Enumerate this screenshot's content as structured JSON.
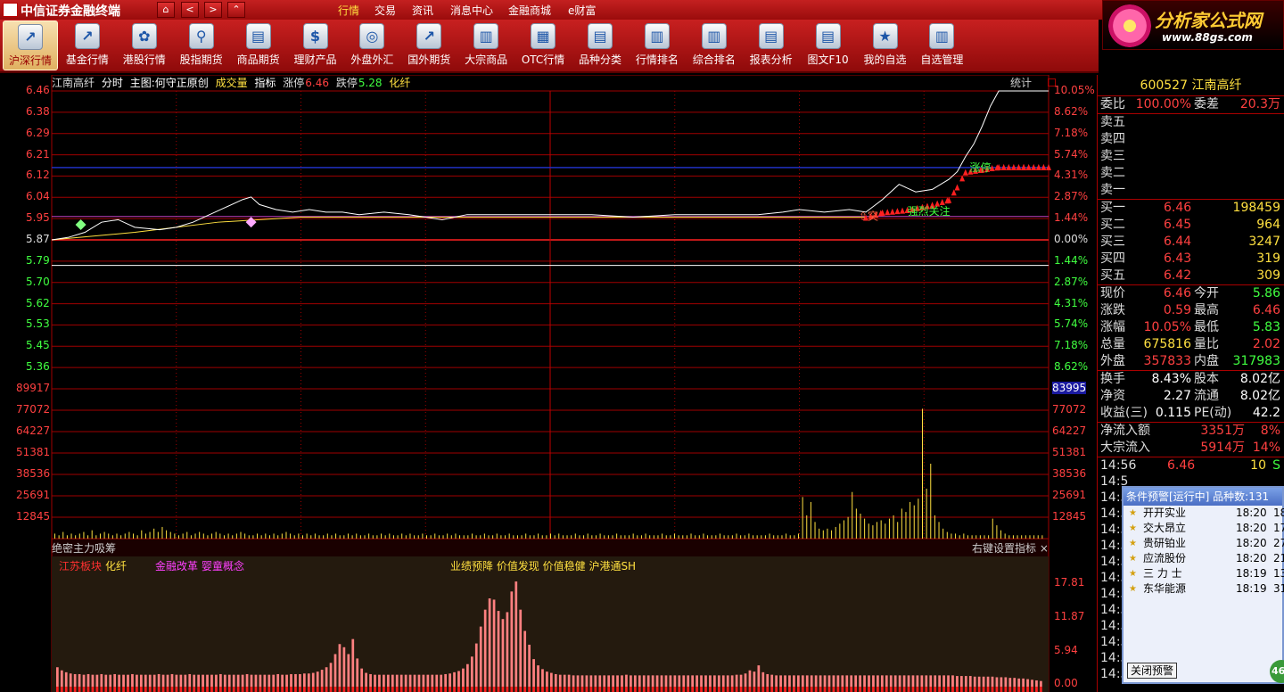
{
  "app": {
    "title": "中信证券金融终端",
    "logo_text": "中信证券"
  },
  "nav_buttons": [
    {
      "icon": "home-icon",
      "glyph": "⌂"
    },
    {
      "icon": "back-icon",
      "glyph": "<"
    },
    {
      "icon": "forward-icon",
      "glyph": ">"
    },
    {
      "icon": "up-icon",
      "glyph": "⌃"
    }
  ],
  "top_menu": [
    "行情",
    "交易",
    "资讯",
    "消息中心",
    "金融商城",
    "e财富"
  ],
  "toolbar": [
    {
      "label": "沪深行情",
      "icon": "market-chart-icon",
      "glyph": "↗",
      "active": true
    },
    {
      "label": "基金行情",
      "icon": "fund-icon",
      "glyph": "↗"
    },
    {
      "label": "港股行情",
      "icon": "hk-stock-icon",
      "glyph": "✿"
    },
    {
      "label": "股指期货",
      "icon": "index-futures-icon",
      "glyph": "⚲"
    },
    {
      "label": "商品期货",
      "icon": "commodity-icon",
      "glyph": "▤"
    },
    {
      "label": "理财产品",
      "icon": "wealth-icon",
      "glyph": "$"
    },
    {
      "label": "外盘外汇",
      "icon": "forex-icon",
      "glyph": "◎"
    },
    {
      "label": "国外期货",
      "icon": "foreign-futures-icon",
      "glyph": "↗"
    },
    {
      "label": "大宗商品",
      "icon": "bulk-icon",
      "glyph": "▥"
    },
    {
      "label": "OTC行情",
      "icon": "otc-icon",
      "glyph": "▦"
    },
    {
      "label": "品种分类",
      "icon": "category-icon",
      "glyph": "▤"
    },
    {
      "label": "行情排名",
      "icon": "rank-icon",
      "glyph": "▥"
    },
    {
      "label": "综合排名",
      "icon": "overall-rank-icon",
      "glyph": "▥"
    },
    {
      "label": "报表分析",
      "icon": "report-icon",
      "glyph": "▤"
    },
    {
      "label": "图文F10",
      "icon": "f10-icon",
      "glyph": "▤"
    },
    {
      "label": "我的自选",
      "icon": "favorites-icon",
      "glyph": "★"
    },
    {
      "label": "自选管理",
      "icon": "favorites-manage-icon",
      "glyph": "▥"
    }
  ],
  "brand": {
    "name": "分析家公式网",
    "url": "www.88gs.com"
  },
  "chart": {
    "stock_name": "江南高纤",
    "mode": "分时",
    "main_indicator": "主图:何守正原创",
    "volume_label": "成交量",
    "indicator_label": "指标",
    "limit_up_label": "涨停",
    "limit_up_value": "6.46",
    "limit_down_label": "跌停",
    "limit_down_value": "5.28",
    "sector": "化纤",
    "stat_button": "统计",
    "price_labels": [
      "6.46",
      "6.38",
      "6.29",
      "6.21",
      "6.12",
      "6.04",
      "5.95",
      "5.87",
      "5.79",
      "5.70",
      "5.62",
      "5.53",
      "5.45",
      "5.36"
    ],
    "pct_labels": [
      "10.05%",
      "8.62%",
      "7.18%",
      "5.74%",
      "4.31%",
      "2.87%",
      "1.44%",
      "0.00%",
      "1.44%",
      "2.87%",
      "4.31%",
      "5.74%",
      "7.18%",
      "8.62%"
    ],
    "volume_labels": [
      "89917",
      "77072",
      "64227",
      "51381",
      "38536",
      "25691",
      "12845"
    ],
    "volume_right_labels": [
      "83995",
      "77072",
      "64227",
      "51381",
      "38536",
      "25691",
      "12845"
    ],
    "annotations": {
      "breakout": "突",
      "strong_watch": "强烈关注",
      "limit_up_mark": "涨停"
    },
    "sub_title": "绝密主力吸筹",
    "sub_right": "右键设置指标",
    "sub_scale": [
      "17.81",
      "11.87",
      "5.94",
      "0.00"
    ],
    "concepts_left": [
      {
        "text": "江苏板块",
        "color": "#ff3030"
      },
      {
        "text": "化纤",
        "color": "#ffe040"
      },
      {
        "text": "金融改革",
        "color": "#ff40ff"
      },
      {
        "text": "婴童概念",
        "color": "#ff40ff"
      }
    ],
    "concepts_right": "业绩预降  价值发现  价值稳健  沪港通SH"
  },
  "chart_data": {
    "type": "line",
    "title": "",
    "xlabel": "",
    "ylabel": "",
    "prev_close": 5.87,
    "ylim": [
      5.28,
      6.46
    ],
    "price_points": [
      [
        0,
        5.87
      ],
      [
        4,
        5.88
      ],
      [
        8,
        5.9
      ],
      [
        12,
        5.94
      ],
      [
        16,
        5.95
      ],
      [
        20,
        5.92
      ],
      [
        26,
        5.91
      ],
      [
        30,
        5.92
      ],
      [
        34,
        5.94
      ],
      [
        38,
        5.97
      ],
      [
        42,
        6.0
      ],
      [
        46,
        6.03
      ],
      [
        48,
        6.04
      ],
      [
        50,
        6.01
      ],
      [
        54,
        5.99
      ],
      [
        58,
        5.98
      ],
      [
        62,
        5.99
      ],
      [
        66,
        5.98
      ],
      [
        70,
        5.98
      ],
      [
        74,
        5.97
      ],
      [
        80,
        5.98
      ],
      [
        86,
        5.97
      ],
      [
        90,
        5.96
      ],
      [
        94,
        5.95
      ],
      [
        100,
        5.97
      ],
      [
        110,
        5.97
      ],
      [
        120,
        5.97
      ],
      [
        130,
        5.97
      ],
      [
        140,
        5.96
      ],
      [
        150,
        5.97
      ],
      [
        160,
        5.97
      ],
      [
        170,
        5.97
      ],
      [
        176,
        5.98
      ],
      [
        180,
        5.99
      ],
      [
        186,
        5.98
      ],
      [
        192,
        5.99
      ],
      [
        196,
        5.98
      ],
      [
        200,
        6.03
      ],
      [
        204,
        6.09
      ],
      [
        208,
        6.06
      ],
      [
        212,
        6.07
      ],
      [
        216,
        6.11
      ],
      [
        218,
        6.14
      ],
      [
        220,
        6.2
      ],
      [
        222,
        6.25
      ],
      [
        224,
        6.32
      ],
      [
        226,
        6.4
      ],
      [
        228,
        6.46
      ],
      [
        240,
        6.46
      ]
    ],
    "avg_points": [
      [
        0,
        5.87
      ],
      [
        20,
        5.9
      ],
      [
        30,
        5.92
      ],
      [
        40,
        5.94
      ],
      [
        60,
        5.96
      ],
      [
        100,
        5.96
      ],
      [
        140,
        5.96
      ],
      [
        170,
        5.96
      ],
      [
        190,
        5.96
      ],
      [
        196,
        5.96
      ]
    ],
    "signal_points": [
      [
        196,
        5.96
      ],
      [
        200,
        5.98
      ],
      [
        206,
        5.99
      ],
      [
        212,
        6.01
      ],
      [
        216,
        6.03
      ],
      [
        218,
        6.08
      ],
      [
        220,
        6.14
      ],
      [
        224,
        6.15
      ],
      [
        228,
        6.16
      ],
      [
        234,
        6.16
      ],
      [
        240,
        6.16
      ]
    ],
    "volume": [
      3,
      2,
      4,
      2,
      3,
      2,
      3,
      4,
      2,
      5,
      2,
      3,
      4,
      3,
      2,
      3,
      2,
      3,
      4,
      3,
      2,
      5,
      3,
      4,
      6,
      4,
      7,
      5,
      4,
      3,
      2,
      3,
      4,
      2,
      3,
      4,
      3,
      2,
      3,
      4,
      3,
      2,
      3,
      2,
      3,
      4,
      3,
      2,
      2,
      3,
      2,
      3,
      2,
      3,
      2,
      3,
      4,
      3,
      2,
      3,
      2,
      3,
      2,
      3,
      2,
      2,
      3,
      2,
      3,
      2,
      2,
      3,
      2,
      3,
      2,
      2,
      3,
      2,
      2,
      3,
      2,
      3,
      2,
      2,
      3,
      2,
      3,
      2,
      2,
      3,
      2,
      2,
      3,
      2,
      2,
      3,
      2,
      3,
      2,
      2,
      2,
      3,
      2,
      2,
      3,
      2,
      2,
      3,
      2,
      2,
      3,
      2,
      2,
      2,
      3,
      2,
      2,
      3,
      2,
      2,
      3,
      2,
      3,
      2,
      2,
      2,
      3,
      2,
      2,
      3,
      2,
      2,
      3,
      2,
      2,
      2,
      3,
      2,
      2,
      2,
      3,
      2,
      2,
      3,
      2,
      2,
      2,
      3,
      2,
      2,
      3,
      2,
      2,
      2,
      3,
      2,
      2,
      3,
      2,
      2,
      2,
      3,
      2,
      2,
      2,
      3,
      2,
      2,
      3,
      2,
      2,
      2,
      2,
      3,
      2,
      2,
      2,
      3,
      2,
      2,
      3,
      25,
      14,
      22,
      10,
      6,
      5,
      6,
      5,
      7,
      9,
      11,
      13,
      28,
      18,
      15,
      12,
      9,
      8,
      10,
      11,
      9,
      12,
      14,
      10,
      18,
      16,
      22,
      20,
      24,
      78,
      30,
      45,
      14,
      10,
      6,
      4,
      3,
      3,
      2,
      3,
      2,
      2,
      2,
      2,
      2,
      2,
      12,
      8,
      5,
      3,
      2,
      2,
      2,
      2,
      2,
      2,
      2,
      2,
      2
    ],
    "sub_values": [
      3.1,
      2.6,
      2.3,
      2.1,
      2.0,
      2.0,
      1.9,
      2.0,
      1.9,
      1.9,
      2.0,
      1.9,
      1.9,
      2.0,
      1.9,
      1.9,
      1.9,
      2.0,
      1.9,
      1.9,
      1.9,
      1.9,
      1.9,
      2.0,
      1.9,
      1.9,
      2.0,
      1.9,
      1.9,
      1.9,
      2.0,
      1.9,
      1.9,
      1.9,
      1.9,
      1.9,
      1.9,
      2.0,
      1.9,
      1.9,
      1.9,
      1.9,
      1.9,
      2.0,
      1.9,
      1.9,
      1.9,
      1.9,
      1.9,
      1.9,
      2.0,
      1.9,
      1.9,
      2.0,
      2.0,
      2.0,
      2.1,
      2.1,
      2.2,
      2.4,
      2.7,
      3.1,
      3.8,
      5.2,
      6.8,
      6.3,
      5.2,
      7.6,
      4.5,
      2.9,
      2.2,
      2.0,
      1.9,
      1.9,
      1.9,
      1.9,
      1.9,
      1.9,
      1.9,
      1.9,
      1.9,
      1.9,
      1.9,
      1.9,
      1.9,
      1.9,
      1.9,
      1.9,
      2.0,
      2.1,
      2.3,
      2.5,
      2.9,
      3.6,
      4.8,
      6.9,
      9.6,
      12.3,
      14.1,
      13.9,
      12.1,
      10.8,
      11.9,
      15.2,
      16.8,
      12.3,
      8.9,
      6.7,
      4.4,
      3.4,
      2.8,
      2.4,
      2.2,
      2.0,
      1.9,
      1.9,
      1.9,
      1.8,
      1.8,
      1.8,
      1.8,
      1.8,
      1.8,
      1.8,
      1.8,
      1.8,
      1.8,
      1.8,
      1.8,
      1.9,
      1.8,
      1.8,
      1.8,
      1.8,
      1.8,
      1.8,
      1.8,
      1.8,
      1.8,
      1.8,
      1.8,
      1.8,
      1.8,
      1.8,
      1.8,
      1.8,
      1.8,
      1.8,
      1.8,
      1.8,
      1.8,
      1.8,
      1.8,
      1.8,
      1.9,
      1.9,
      2.1,
      2.6,
      2.4,
      3.4,
      2.3,
      2.0,
      1.9,
      1.8,
      1.8,
      1.8,
      1.8,
      1.8,
      1.8,
      1.8,
      1.8,
      1.8,
      1.8,
      1.8,
      1.8,
      1.8,
      1.8,
      1.8,
      1.8,
      1.8,
      1.8,
      1.8,
      1.8,
      1.8,
      1.8,
      1.8,
      1.8,
      1.8,
      1.8,
      1.8,
      1.8,
      1.8,
      1.8,
      1.8,
      1.8,
      1.8,
      1.8,
      1.8,
      1.8,
      1.8,
      1.8,
      1.8,
      1.8,
      1.8,
      1.7,
      1.7,
      1.7,
      1.7,
      1.6,
      1.6,
      1.6,
      1.6,
      1.6,
      1.5,
      1.5,
      1.5,
      1.4,
      1.4,
      1.3,
      1.3,
      1.2,
      1.1,
      1.0,
      0.9
    ]
  },
  "quote": {
    "code": "600527",
    "name": "江南高纤",
    "weibi_label": "委比",
    "weibi": "100.00%",
    "weicha_label": "委差",
    "weicha": "20.3万",
    "asks": [
      {
        "label": "卖五"
      },
      {
        "label": "卖四"
      },
      {
        "label": "卖三"
      },
      {
        "label": "卖二"
      },
      {
        "label": "卖一"
      }
    ],
    "bids": [
      {
        "label": "买一",
        "price": "6.46",
        "vol": "198459"
      },
      {
        "label": "买二",
        "price": "6.45",
        "vol": "964"
      },
      {
        "label": "买三",
        "price": "6.44",
        "vol": "3247"
      },
      {
        "label": "买四",
        "price": "6.43",
        "vol": "319"
      },
      {
        "label": "买五",
        "price": "6.42",
        "vol": "309"
      }
    ],
    "stats": [
      {
        "k1": "现价",
        "v1": "6.46",
        "c1": "red",
        "k2": "今开",
        "v2": "5.86",
        "c2": "grn"
      },
      {
        "k1": "涨跌",
        "v1": "0.59",
        "c1": "red",
        "k2": "最高",
        "v2": "6.46",
        "c2": "red"
      },
      {
        "k1": "涨幅",
        "v1": "10.05%",
        "c1": "red",
        "k2": "最低",
        "v2": "5.83",
        "c2": "grn"
      },
      {
        "k1": "总量",
        "v1": "675816",
        "c1": "yel",
        "k2": "量比",
        "v2": "2.02",
        "c2": "red"
      },
      {
        "k1": "外盘",
        "v1": "357833",
        "c1": "red",
        "k2": "内盘",
        "v2": "317983",
        "c2": "grn"
      }
    ],
    "stats2": [
      {
        "k1": "换手",
        "v1": "8.43%",
        "c1": "wht",
        "k2": "股本",
        "v2": "8.02亿",
        "c2": "wht"
      },
      {
        "k1": "净资",
        "v1": "2.27",
        "c1": "wht",
        "k2": "流通",
        "v2": "8.02亿",
        "c2": "wht"
      },
      {
        "k1": "收益(三)",
        "v1": "0.115",
        "c1": "wht",
        "k2": "PE(动)",
        "v2": "42.2",
        "c2": "wht"
      }
    ],
    "flows": [
      {
        "k": "净流入额",
        "v": "3351万",
        "p": "8%"
      },
      {
        "k": "大宗流入",
        "v": "5914万",
        "p": "14%"
      }
    ],
    "ticks": [
      {
        "t": "14:56",
        "p": "6.46",
        "v": "10",
        "s": "S"
      },
      {
        "t": "14:5"
      },
      {
        "t": "14:5"
      },
      {
        "t": "14:5"
      },
      {
        "t": "14:5"
      },
      {
        "t": "14:5"
      },
      {
        "t": "14:5"
      },
      {
        "t": "14:5"
      },
      {
        "t": "14:5"
      },
      {
        "t": "14:5"
      },
      {
        "t": "14:5"
      },
      {
        "t": "14:5"
      },
      {
        "t": "14:5"
      },
      {
        "t": "14:5"
      }
    ]
  },
  "alert": {
    "title": "条件预警[运行中] 品种数:131",
    "items": [
      {
        "name": "开开实业",
        "time": "18:20",
        "n": "18"
      },
      {
        "name": "交大昂立",
        "time": "18:20",
        "n": "17"
      },
      {
        "name": "贵研铂业",
        "time": "18:20",
        "n": "27"
      },
      {
        "name": "应流股份",
        "time": "18:20",
        "n": "21"
      },
      {
        "name": "三 力 士",
        "time": "18:19",
        "n": "13"
      },
      {
        "name": "东华能源",
        "time": "18:19",
        "n": "31"
      }
    ],
    "close_label": "关闭预警",
    "badge": "46"
  },
  "colors": {
    "price_line": "#ffffff",
    "avg_line": "#ffe040",
    "grid": "#a00000",
    "up": "#ff3030",
    "down": "#40ff40",
    "signal": "#ff2020"
  }
}
